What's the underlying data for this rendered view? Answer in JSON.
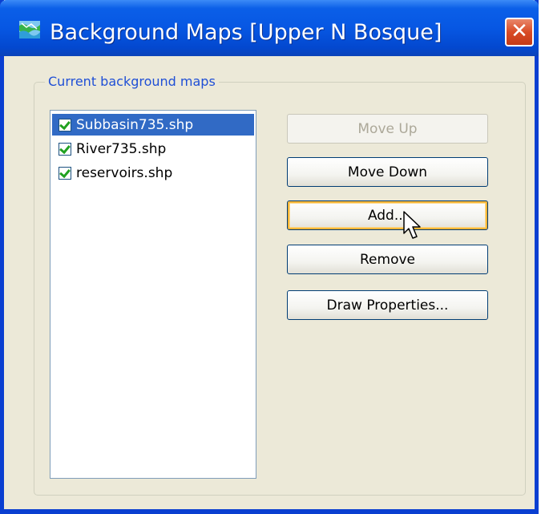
{
  "window": {
    "title": "Background Maps [Upper N Bosque]",
    "close_glyph": "✕"
  },
  "group": {
    "legend": "Current background maps"
  },
  "maps_list": {
    "items": [
      {
        "label": "Subbasin735.shp",
        "checked": true,
        "selected": true
      },
      {
        "label": "River735.shp",
        "checked": true,
        "selected": false
      },
      {
        "label": "reservoirs.shp",
        "checked": true,
        "selected": false
      }
    ]
  },
  "buttons": {
    "move_up": "Move Up",
    "move_down": "Move Down",
    "add": "Add...",
    "remove": "Remove",
    "draw_properties": "Draw Properties..."
  },
  "colors": {
    "titlebar": "#0757e3",
    "selection": "#316ac5",
    "legend_text": "#1f4fd6",
    "dialog_bg": "#ece9d8"
  },
  "icons": {
    "app": "map-icon",
    "close": "close-icon",
    "checkbox": "checkmark-icon",
    "cursor": "arrow-cursor-icon"
  }
}
